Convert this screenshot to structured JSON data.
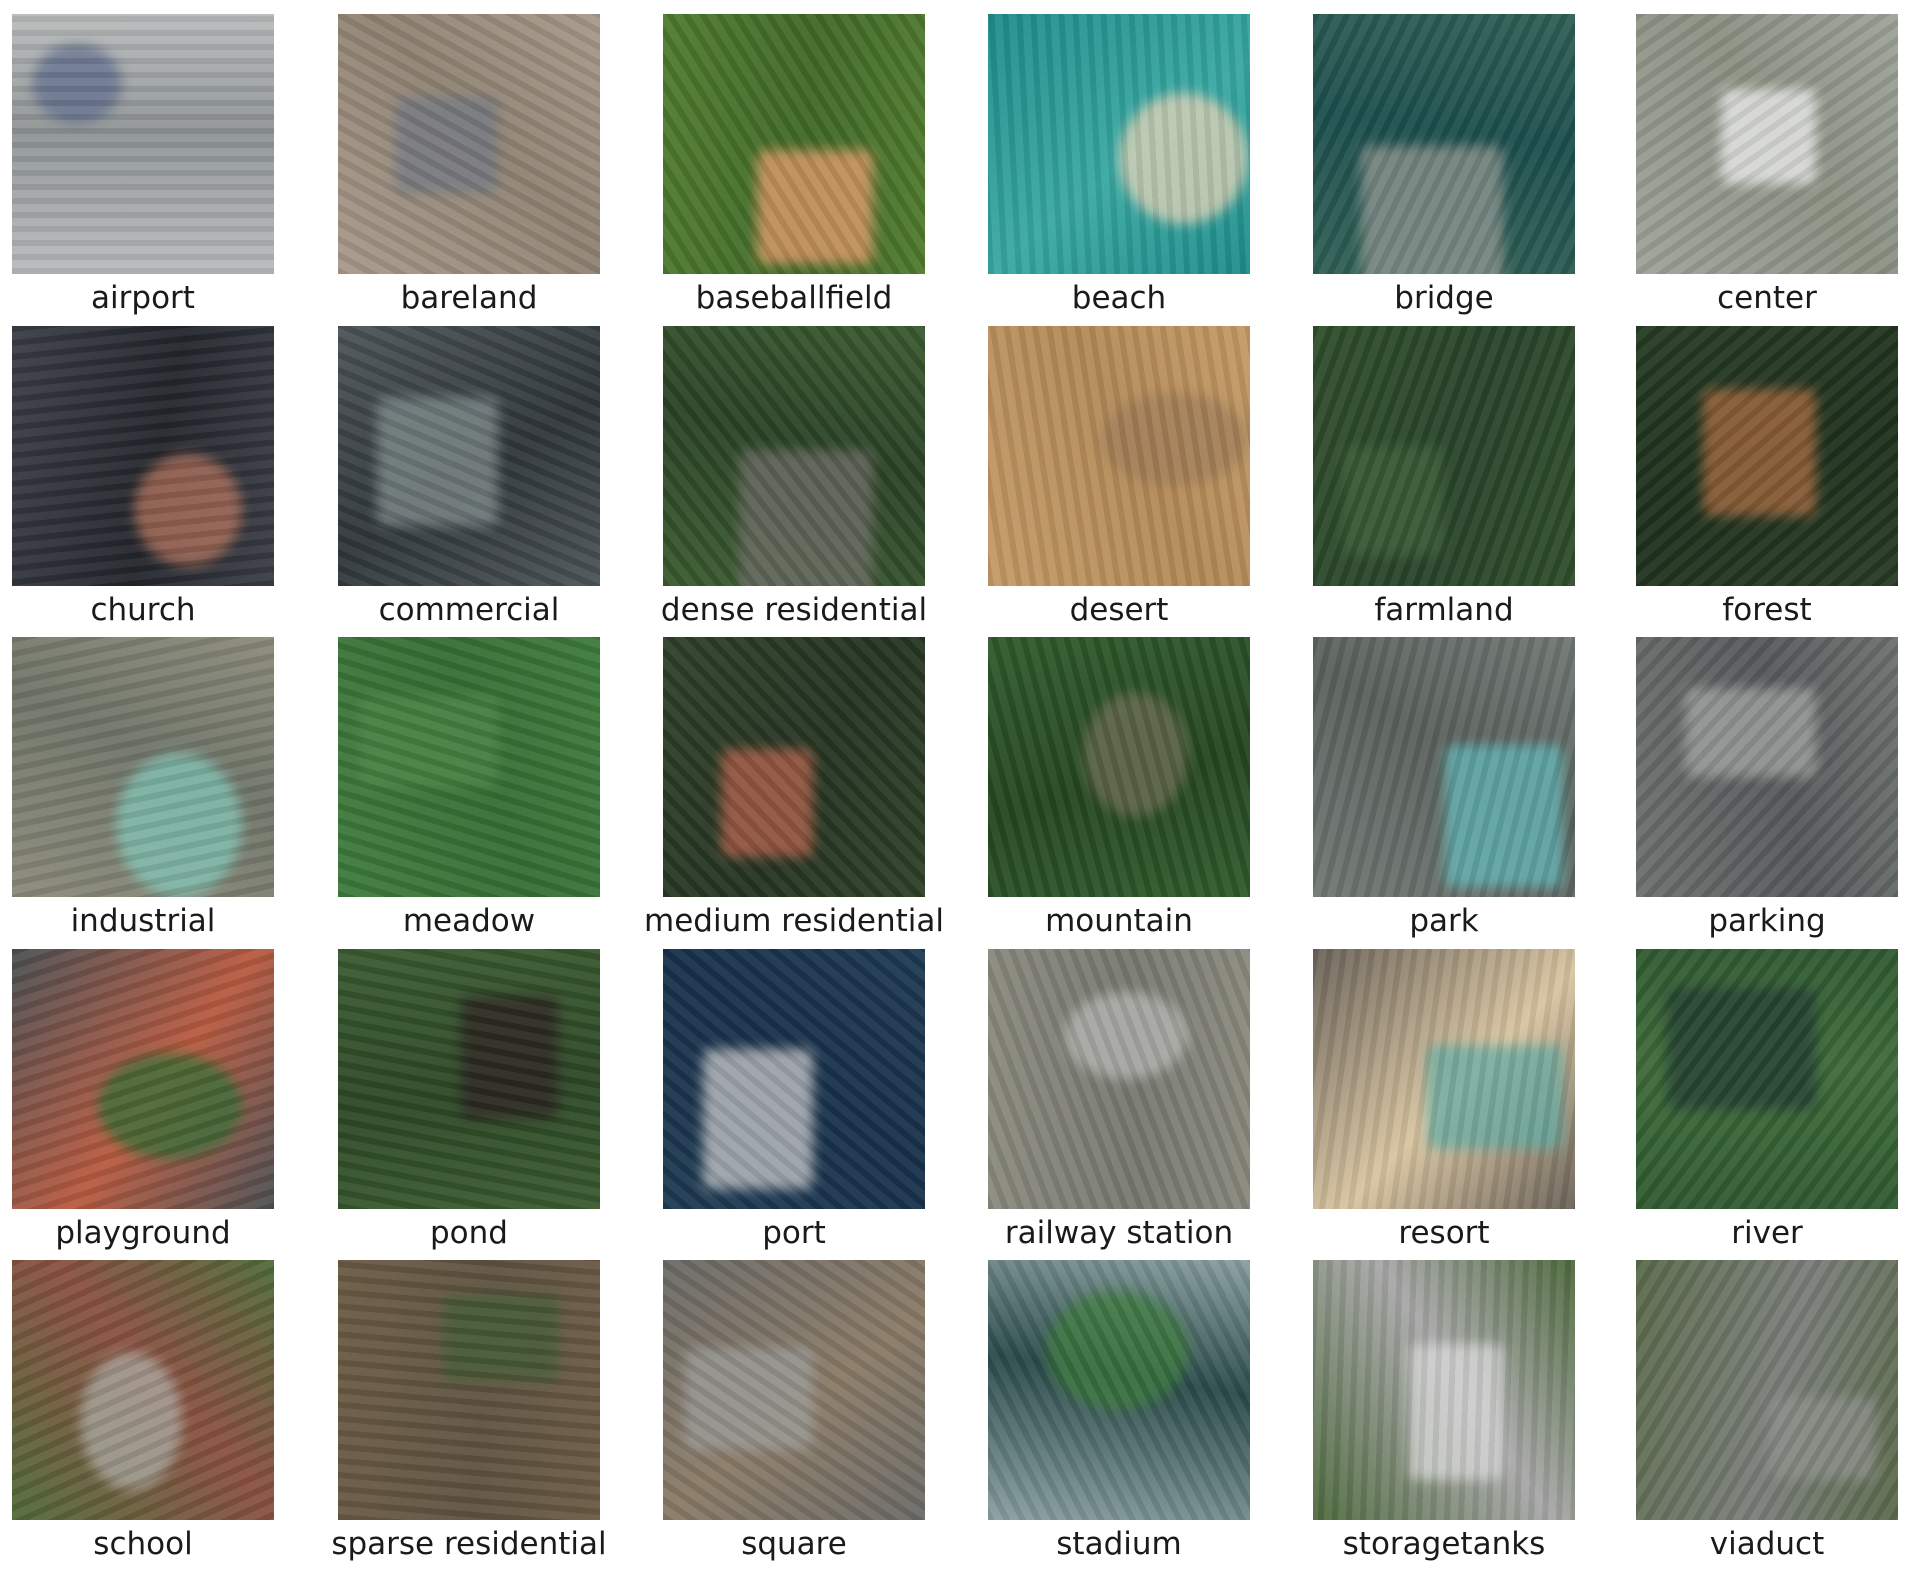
{
  "figure": {
    "tiles": [
      {
        "label": "airport",
        "colors": [
          "#b9bcbc",
          "#8f9494",
          "#5d6a8a"
        ]
      },
      {
        "label": "bareland",
        "colors": [
          "#a8998a",
          "#8f8272",
          "#6f7580"
        ]
      },
      {
        "label": "baseballfield",
        "colors": [
          "#4f7a2e",
          "#3f6826",
          "#e89a6a"
        ]
      },
      {
        "label": "beach",
        "colors": [
          "#1f8c8a",
          "#39a8a2",
          "#e6d2b4"
        ]
      },
      {
        "label": "bridge",
        "colors": [
          "#2f5f55",
          "#1d4f4d",
          "#8f948e"
        ]
      },
      {
        "label": "center",
        "colors": [
          "#9ea39a",
          "#8a9082",
          "#eeeeee"
        ]
      },
      {
        "label": "church",
        "colors": [
          "#3a3d45",
          "#22252b",
          "#b0705a"
        ]
      },
      {
        "label": "commercial",
        "colors": [
          "#4c5458",
          "#2f3639",
          "#7e8a8a"
        ]
      },
      {
        "label": "dense residential",
        "colors": [
          "#3a5a2f",
          "#2a4225",
          "#6c6a64"
        ]
      },
      {
        "label": "desert",
        "colors": [
          "#c49a66",
          "#b38a58",
          "#9d7a55"
        ]
      },
      {
        "label": "farmland",
        "colors": [
          "#2f4d2a",
          "#28442a",
          "#3d5d38"
        ]
      },
      {
        "label": "forest",
        "colors": [
          "#263b23",
          "#1e311d",
          "#a8683e"
        ]
      },
      {
        "label": "industrial",
        "colors": [
          "#8a8a7a",
          "#6f7468",
          "#7fc4b4"
        ]
      },
      {
        "label": "meadow",
        "colors": [
          "#3e7a3c",
          "#356e34",
          "#4a8444"
        ]
      },
      {
        "label": "medium residential",
        "colors": [
          "#2e3f27",
          "#253422",
          "#b4604a"
        ]
      },
      {
        "label": "mountain",
        "colors": [
          "#2f5a2c",
          "#24461f",
          "#6a6a50"
        ]
      },
      {
        "label": "park",
        "colors": [
          "#707874",
          "#5a605c",
          "#5fb8b8"
        ]
      },
      {
        "label": "parking",
        "colors": [
          "#6c706e",
          "#55595a",
          "#a0a3a0"
        ]
      },
      {
        "label": "playground",
        "colors": [
          "#4a4f52",
          "#b85a40",
          "#2e6a30"
        ]
      },
      {
        "label": "pond",
        "colors": [
          "#3a5a30",
          "#2c4826",
          "#2a1f1f"
        ]
      },
      {
        "label": "port",
        "colors": [
          "#1e3a52",
          "#17304a",
          "#c8c8c8"
        ]
      },
      {
        "label": "railway station",
        "colors": [
          "#8a8a7e",
          "#77786f",
          "#b4b6b2"
        ]
      },
      {
        "label": "resort",
        "colors": [
          "#6a6258",
          "#d8c4a0",
          "#5fa8a0"
        ]
      },
      {
        "label": "river",
        "colors": [
          "#2f5a30",
          "#3e6a3a",
          "#1f3a30"
        ]
      },
      {
        "label": "school",
        "colors": [
          "#4f6a3a",
          "#8a5040",
          "#a8a8a0"
        ]
      },
      {
        "label": "sparse residential",
        "colors": [
          "#6a5a44",
          "#5e5240",
          "#3e5a30"
        ]
      },
      {
        "label": "square",
        "colors": [
          "#6a6a66",
          "#8a7a66",
          "#9a9a98"
        ]
      },
      {
        "label": "stadium",
        "colors": [
          "#8aa0a0",
          "#2a4a4a",
          "#3a7a3a"
        ]
      },
      {
        "label": "storagetanks",
        "colors": [
          "#4e6a3e",
          "#a8a8a8",
          "#d8d8d8"
        ]
      },
      {
        "label": "viaduct",
        "colors": [
          "#5a6a4a",
          "#7a7e7a",
          "#8a8e88"
        ]
      }
    ]
  }
}
